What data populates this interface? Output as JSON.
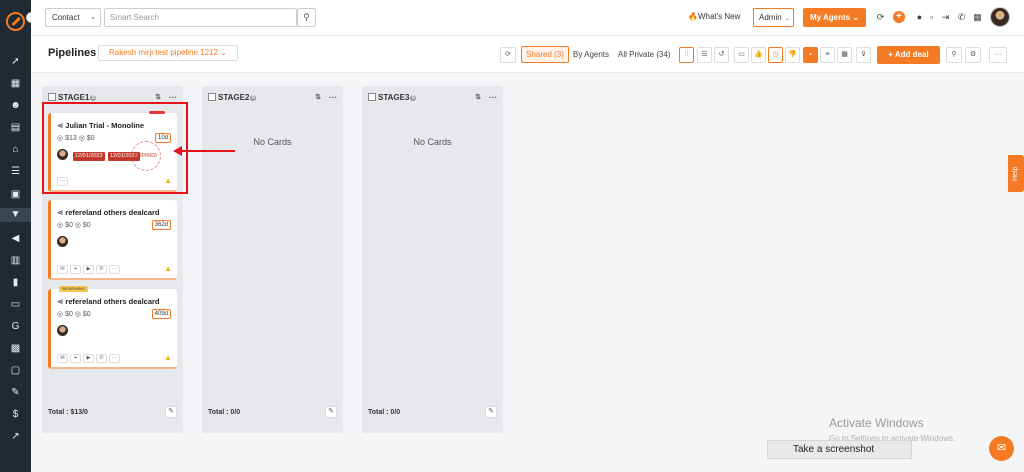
{
  "topbar": {
    "contact_select": "Contact",
    "search_placeholder": "Smart Search",
    "whats_new": "What's New",
    "admin_select": "Admin",
    "my_agents": "My Agents"
  },
  "subbar": {
    "title": "Pipelines",
    "pipeline_select": "Rakesh mirji test pipeline 1212",
    "shared": "Shared (3)",
    "by_agents": "By Agents",
    "all_private": "All Private (34)",
    "add_deal": "+ Add deal"
  },
  "columns": [
    {
      "name": "STAGE1",
      "badge": "0",
      "total": "Total : $13/0",
      "empty_text": ""
    },
    {
      "name": "STAGE2",
      "badge": "0",
      "total": "Total : 0/0",
      "empty_text": "No Cards"
    },
    {
      "name": "STAGE3",
      "badge": "0",
      "total": "Total : 0/0",
      "empty_text": "No Cards"
    }
  ],
  "cards": [
    {
      "title": "Julian Trial - Monoline",
      "amount1": "$13",
      "amount2": "$0",
      "days": "10d",
      "date1": "12/01/2023",
      "date2": "12/01/2023",
      "stamp": "EXPIRED",
      "tag": ""
    },
    {
      "title": "refereland others dealcard",
      "amount1": "$0",
      "amount2": "$0",
      "days": "362d",
      "tag": ""
    },
    {
      "title": "refereland others dealcard",
      "amount1": "$0",
      "amount2": "$0",
      "days": "409d",
      "tag": "REVIEWING"
    }
  ],
  "overlay": {
    "help": "Help",
    "activate_title": "Activate Windows",
    "activate_sub": "Go to Settings to activate Windows.",
    "take_screenshot": "Take a screenshot"
  },
  "colors": {
    "accent": "#f47a24",
    "sidebar": "#1f2a33",
    "annotation_red": "#e3151a"
  }
}
